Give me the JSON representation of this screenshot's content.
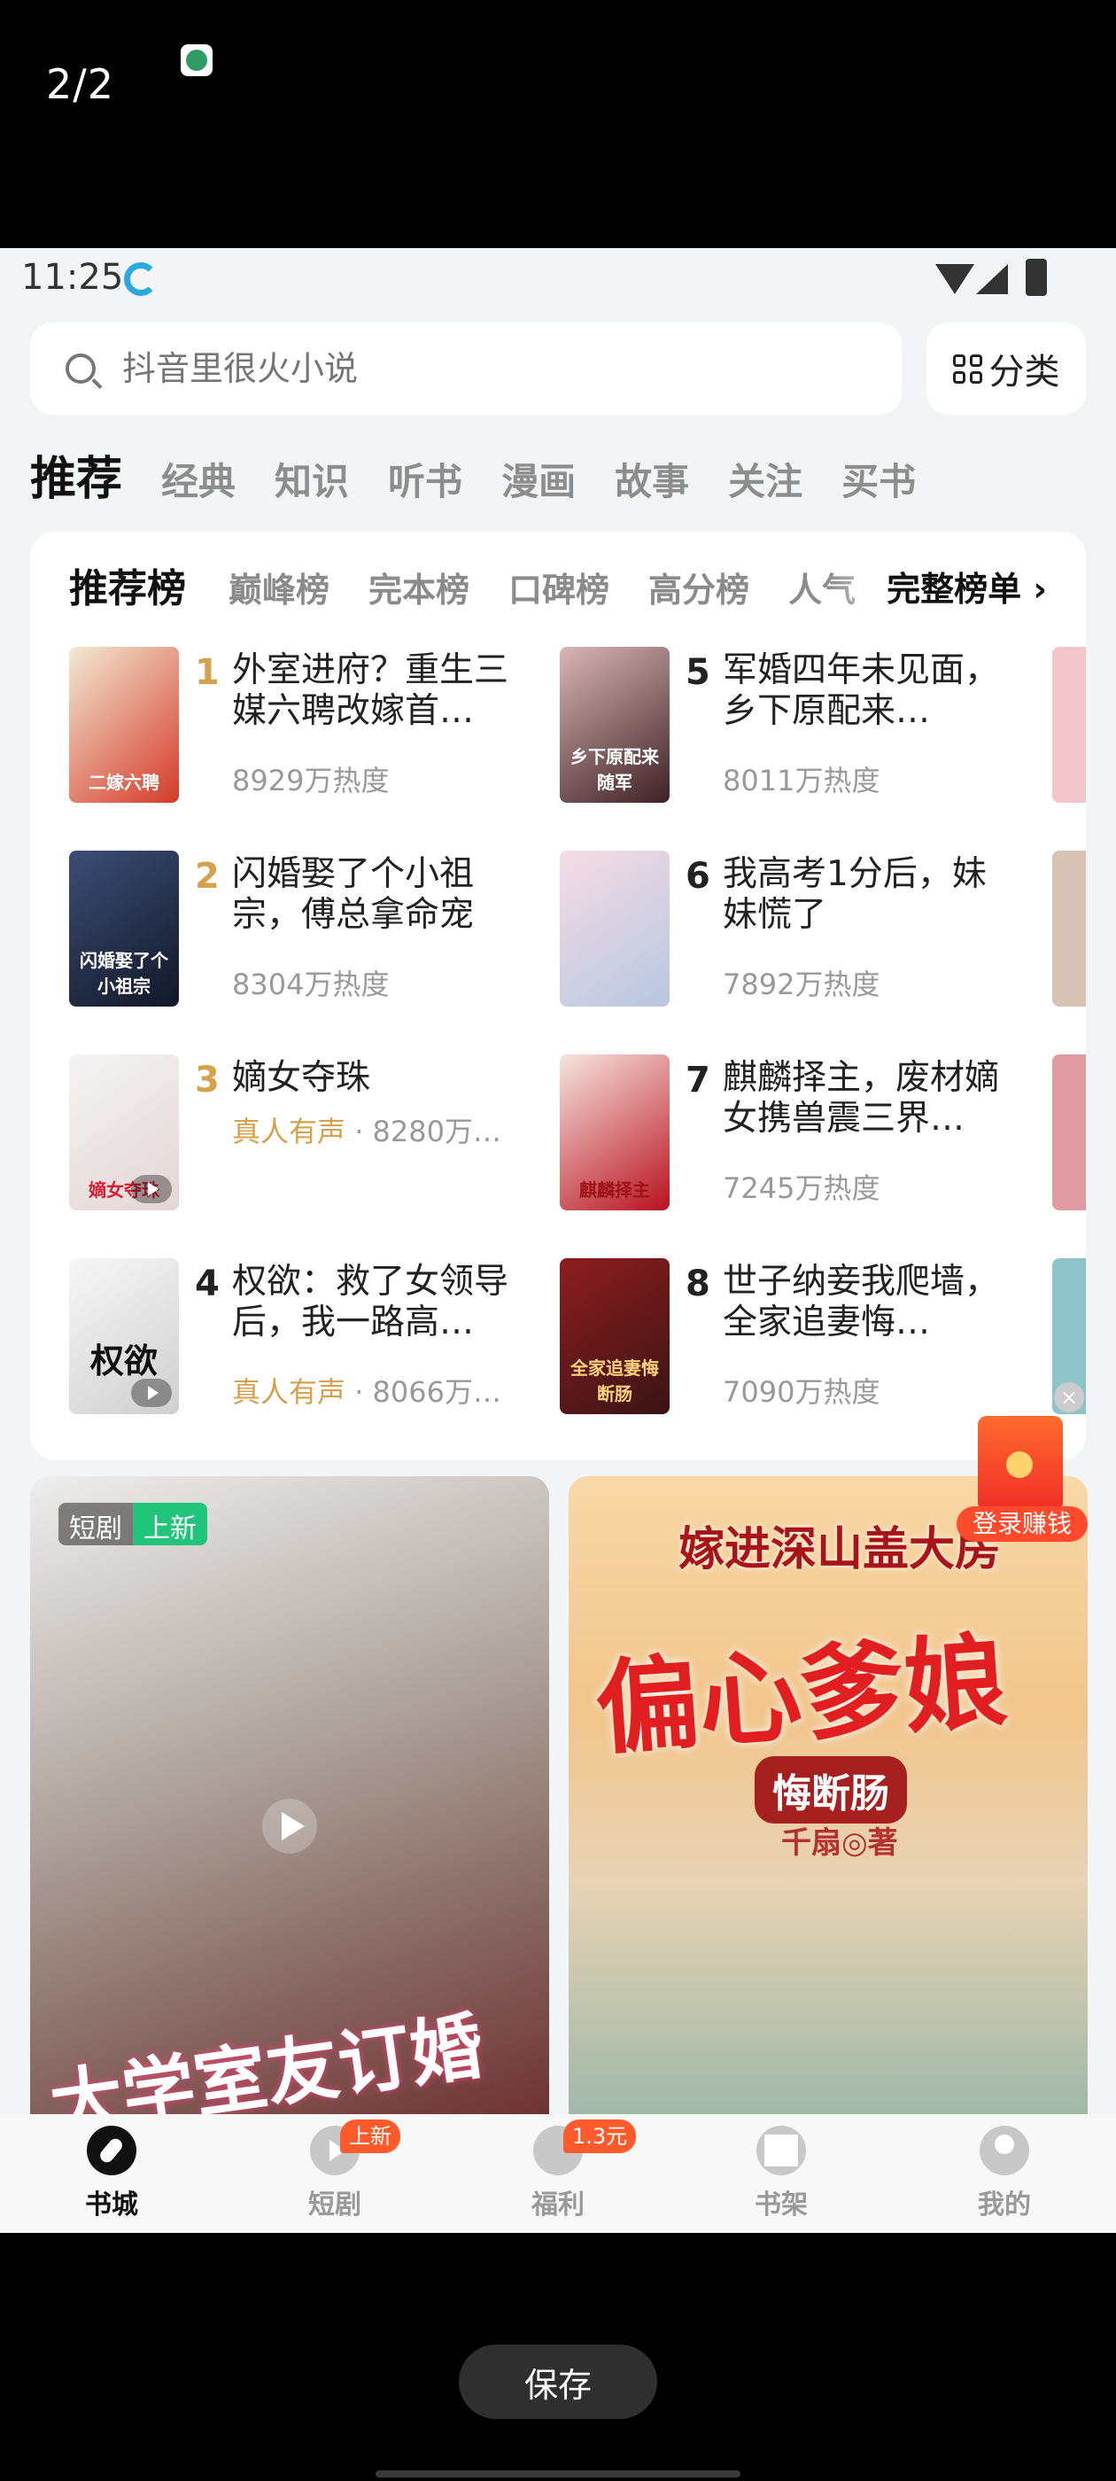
{
  "viewer": {
    "page_counter": "2/2",
    "save_button": "保存"
  },
  "status_bar": {
    "time": "11:25"
  },
  "search": {
    "placeholder": "抖音里很火小说",
    "category_label": "分类"
  },
  "top_tabs": [
    "推荐",
    "经典",
    "知识",
    "听书",
    "漫画",
    "故事",
    "关注",
    "买书"
  ],
  "ranking": {
    "tabs": [
      "推荐榜",
      "巅峰榜",
      "完本榜",
      "口碑榜",
      "高分榜",
      "人气"
    ],
    "full_list_label": "完整榜单 ›",
    "books": [
      {
        "rank": "1",
        "title": "外室进府？重生三媒六聘改嫁首…",
        "meta": "8929万热度",
        "audio": "",
        "cover_text": "二嫁六聘"
      },
      {
        "rank": "2",
        "title": "闪婚娶了个小祖宗，傅总拿命宠",
        "meta": "8304万热度",
        "audio": "",
        "cover_text": "闪婚娶了个小祖宗"
      },
      {
        "rank": "3",
        "title": "嫡女夺珠",
        "meta": "8280万…",
        "audio": "真人有声",
        "cover_text": "嫡女夺珠"
      },
      {
        "rank": "4",
        "title": "权欲：救了女领导后，我一路高…",
        "meta": "8066万…",
        "audio": "真人有声",
        "cover_text": "权欲"
      },
      {
        "rank": "5",
        "title": "军婚四年未见面，乡下原配来…",
        "meta": "8011万热度",
        "audio": "",
        "cover_text": "乡下原配来随军"
      },
      {
        "rank": "6",
        "title": "我高考1分后，妹妹慌了",
        "meta": "7892万热度",
        "audio": "",
        "cover_text": ""
      },
      {
        "rank": "7",
        "title": "麒麟择主，废材嫡女携兽震三界…",
        "meta": "7245万热度",
        "audio": "",
        "cover_text": "麒麟择主"
      },
      {
        "rank": "8",
        "title": "世子纳妾我爬墙，全家追妻悔…",
        "meta": "7090万热度",
        "audio": "",
        "cover_text": "全家追妻悔断肠"
      }
    ]
  },
  "feed": {
    "drama": {
      "badge_type": "短剧",
      "badge_new": "上新",
      "title": "大学室友订婚"
    },
    "novel": {
      "top_title": "嫁进深山盖大房",
      "big_title": "偏心爹娘",
      "subtitle": "悔断肠",
      "author": "千扇◎著"
    }
  },
  "floating_reward": {
    "label": "登录赚钱"
  },
  "bottom_nav": [
    {
      "label": "书城",
      "badge": ""
    },
    {
      "label": "短剧",
      "badge": "上新"
    },
    {
      "label": "福利",
      "badge": "1.3元"
    },
    {
      "label": "书架",
      "badge": ""
    },
    {
      "label": "我的",
      "badge": ""
    }
  ],
  "colors": {
    "accent_gold": "#d6a14c",
    "new_green": "#20c47a",
    "reward_red": "#ff4b2b"
  }
}
